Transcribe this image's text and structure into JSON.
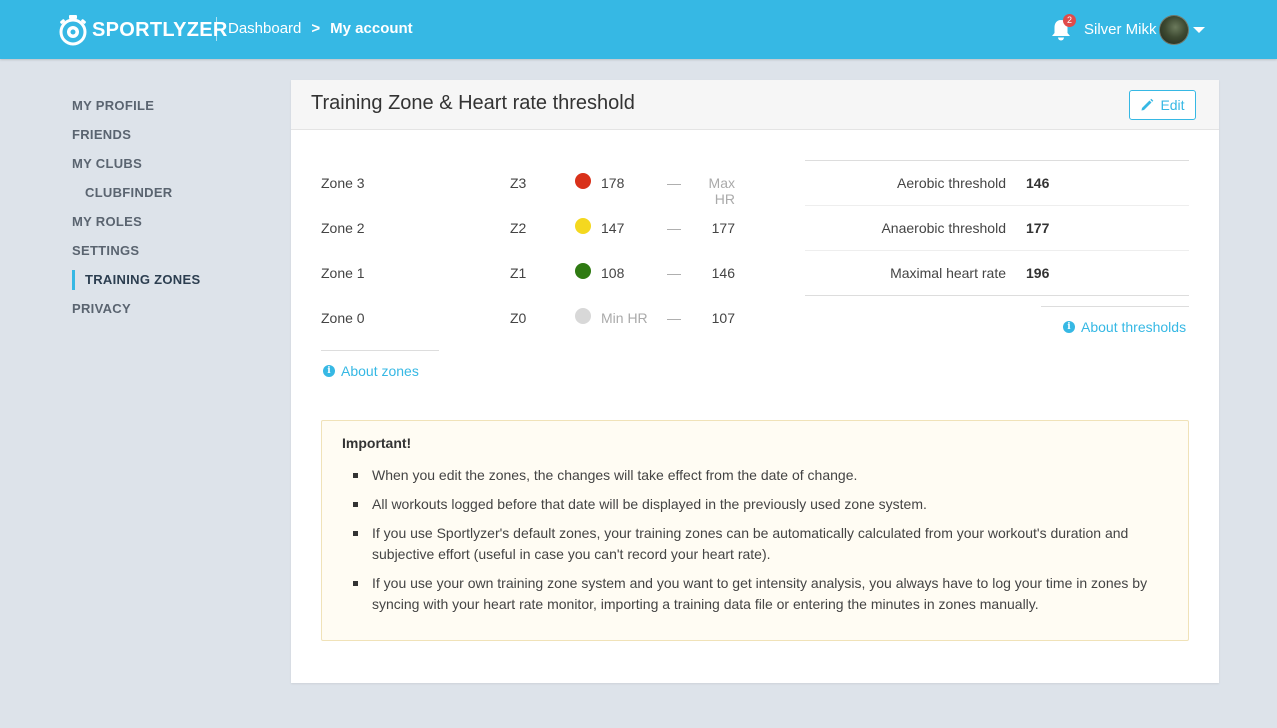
{
  "header": {
    "brand": "SPORTLYZER",
    "breadcrumb_root": "Dashboard",
    "breadcrumb_sep": ">",
    "breadcrumb_current": "My account",
    "notification_count": "2",
    "user_name": "Silver Mikk"
  },
  "sidebar": {
    "items": [
      {
        "label": "MY PROFILE"
      },
      {
        "label": "FRIENDS"
      },
      {
        "label": "MY CLUBS"
      },
      {
        "label": "CLUBFINDER"
      },
      {
        "label": "MY ROLES"
      },
      {
        "label": "SETTINGS"
      },
      {
        "label": "TRAINING ZONES"
      },
      {
        "label": "PRIVACY"
      }
    ]
  },
  "panel": {
    "title": "Training Zone & Heart rate threshold",
    "edit_label": "Edit"
  },
  "zones": [
    {
      "name": "Zone 3",
      "code": "Z3",
      "color": "#d9311a",
      "low": "178",
      "dash": "—",
      "high": "Max HR"
    },
    {
      "name": "Zone 2",
      "code": "Z2",
      "color": "#f4d81f",
      "low": "147",
      "dash": "—",
      "high": "177"
    },
    {
      "name": "Zone 1",
      "code": "Z1",
      "color": "#2f7a12",
      "low": "108",
      "dash": "—",
      "high": "146"
    },
    {
      "name": "Zone 0",
      "code": "Z0",
      "color": "#d8d8d8",
      "low": "Min HR",
      "dash": "—",
      "high": "107"
    }
  ],
  "about_zones": "About zones",
  "thresholds": [
    {
      "label": "Aerobic threshold",
      "value": "146"
    },
    {
      "label": "Anaerobic threshold",
      "value": "177"
    },
    {
      "label": "Maximal heart rate",
      "value": "196"
    }
  ],
  "about_thresholds": "About thresholds",
  "notice": {
    "title": "Important!",
    "items": [
      "When you edit the zones, the changes will take effect from the date of change.",
      "All workouts logged before that date will be displayed in the previously used zone system.",
      "If you use Sportlyzer's default zones, your training zones can be automatically calculated from your workout's duration and subjective effort (useful in case you can't record your heart rate).",
      "If you use your own training zone system and you want to get intensity analysis, you always have to log your time in zones by syncing with your heart rate monitor, importing a training data file or entering the minutes in zones manually."
    ]
  },
  "colors": {
    "accent": "#36b8e4",
    "background": "#dde3ea",
    "badge": "#e04b4b"
  }
}
